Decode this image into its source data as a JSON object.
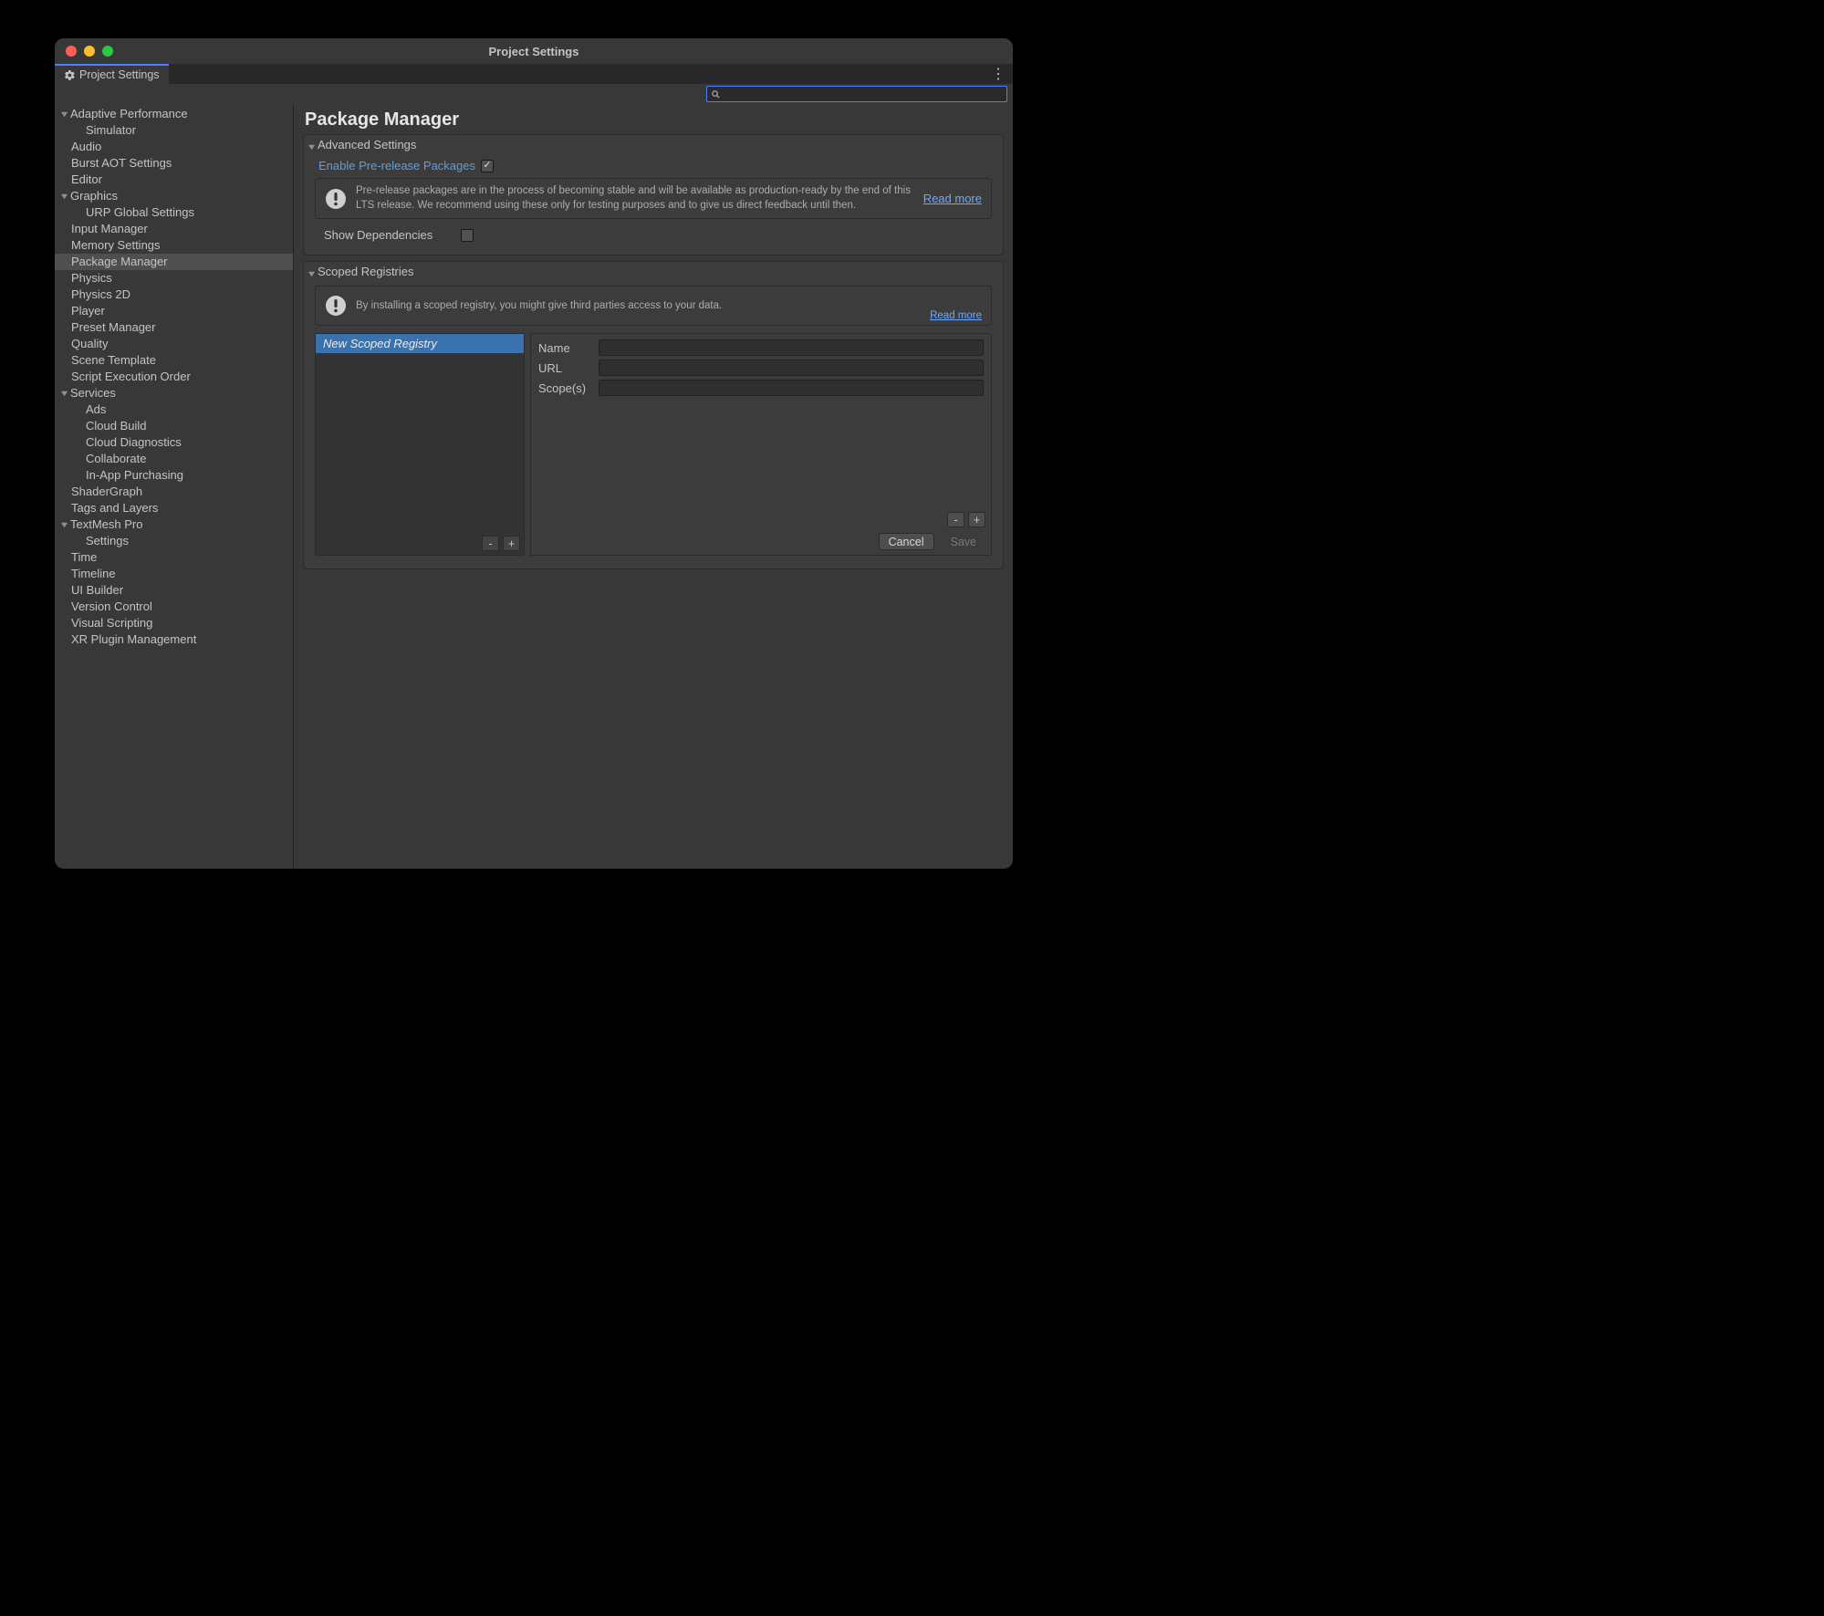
{
  "window": {
    "title": "Project Settings"
  },
  "tab": {
    "label": "Project Settings"
  },
  "search": {
    "value": ""
  },
  "sidebar": {
    "items": [
      {
        "label": "Adaptive Performance",
        "depth": 0,
        "expandable": true
      },
      {
        "label": "Simulator",
        "depth": 2
      },
      {
        "label": "Audio",
        "depth": 1
      },
      {
        "label": "Burst AOT Settings",
        "depth": 1
      },
      {
        "label": "Editor",
        "depth": 1
      },
      {
        "label": "Graphics",
        "depth": 0,
        "expandable": true
      },
      {
        "label": "URP Global Settings",
        "depth": 2
      },
      {
        "label": "Input Manager",
        "depth": 1
      },
      {
        "label": "Memory Settings",
        "depth": 1
      },
      {
        "label": "Package Manager",
        "depth": 1,
        "selected": true
      },
      {
        "label": "Physics",
        "depth": 1
      },
      {
        "label": "Physics 2D",
        "depth": 1
      },
      {
        "label": "Player",
        "depth": 1
      },
      {
        "label": "Preset Manager",
        "depth": 1
      },
      {
        "label": "Quality",
        "depth": 1
      },
      {
        "label": "Scene Template",
        "depth": 1
      },
      {
        "label": "Script Execution Order",
        "depth": 1
      },
      {
        "label": "Services",
        "depth": 0,
        "expandable": true
      },
      {
        "label": "Ads",
        "depth": 2
      },
      {
        "label": "Cloud Build",
        "depth": 2
      },
      {
        "label": "Cloud Diagnostics",
        "depth": 2
      },
      {
        "label": "Collaborate",
        "depth": 2
      },
      {
        "label": "In-App Purchasing",
        "depth": 2
      },
      {
        "label": "ShaderGraph",
        "depth": 1
      },
      {
        "label": "Tags and Layers",
        "depth": 1
      },
      {
        "label": "TextMesh Pro",
        "depth": 0,
        "expandable": true
      },
      {
        "label": "Settings",
        "depth": 2
      },
      {
        "label": "Time",
        "depth": 1
      },
      {
        "label": "Timeline",
        "depth": 1
      },
      {
        "label": "UI Builder",
        "depth": 1
      },
      {
        "label": "Version Control",
        "depth": 1
      },
      {
        "label": "Visual Scripting",
        "depth": 1
      },
      {
        "label": "XR Plugin Management",
        "depth": 1
      }
    ]
  },
  "page": {
    "title": "Package Manager",
    "advanced": {
      "header": "Advanced Settings",
      "enable_prerelease": {
        "label": "Enable Pre-release Packages",
        "checked": true
      },
      "prerelease_info": "Pre-release packages are in the process of becoming stable and will be available as production-ready by the end of this LTS release. We recommend using these only for testing purposes and to give us direct feedback until then.",
      "read_more": "Read more",
      "show_deps": {
        "label": "Show Dependencies",
        "checked": false
      }
    },
    "scoped": {
      "header": "Scoped Registries",
      "info": "By installing a scoped registry, you might give third parties access to your data.",
      "read_more": "Read more",
      "list": {
        "items": [
          "New Scoped Registry"
        ],
        "selected_index": 0
      },
      "form": {
        "name": {
          "label": "Name",
          "value": ""
        },
        "url": {
          "label": "URL",
          "value": ""
        },
        "scopes": {
          "label": "Scope(s)",
          "value": ""
        }
      },
      "buttons": {
        "minus": "-",
        "plus": "+",
        "cancel": "Cancel",
        "save": "Save"
      }
    }
  }
}
